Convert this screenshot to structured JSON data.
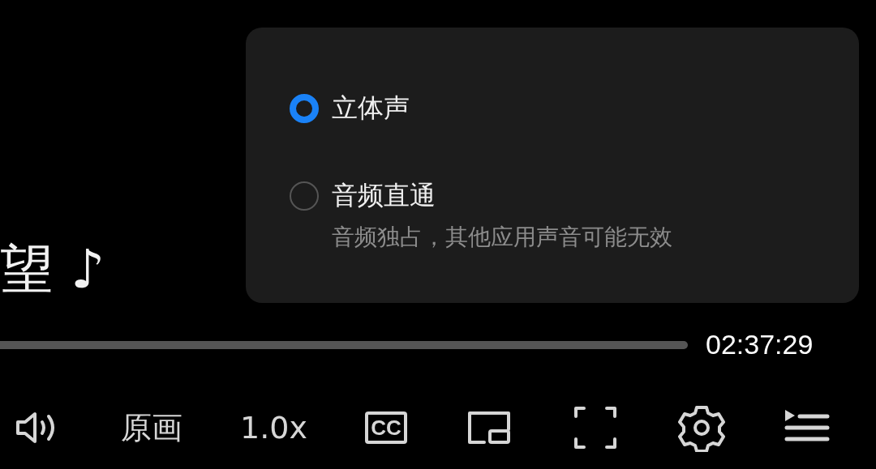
{
  "subtitle": "望 ♪",
  "progress": {
    "time": "02:37:29"
  },
  "audio_menu": {
    "options": [
      {
        "label": "立体声",
        "selected": true
      },
      {
        "label": "音频直通",
        "selected": false,
        "description": "音频独占，其他应用声音可能无效"
      }
    ]
  },
  "controls": [
    {
      "kind": "volume"
    },
    {
      "kind": "text",
      "label": "原画"
    },
    {
      "kind": "text",
      "label": "1.0x"
    },
    {
      "kind": "cc",
      "label": "CC"
    },
    {
      "kind": "pip"
    },
    {
      "kind": "fullscreen"
    },
    {
      "kind": "settings"
    },
    {
      "kind": "playlist"
    }
  ]
}
